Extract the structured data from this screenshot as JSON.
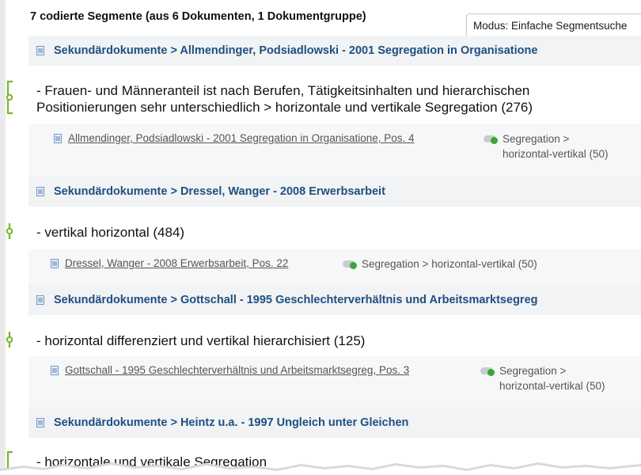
{
  "header": {
    "title": "7 codierte Segmente (aus 6 Dokumenten, 1 Dokumentgruppe)"
  },
  "mode_select": {
    "label": "Modus: Einfache Segmentsuche"
  },
  "documents": [
    {
      "title": "Sekundärdokumente > Allmendinger, Podsiadlowski - 2001 Segregation in Organisatione"
    },
    {
      "title": "Sekundärdokumente > Dressel, Wanger - 2008 Erwerbsarbeit"
    },
    {
      "title": "Sekundärdokumente > Gottschall - 1995 Geschlechterverhältnis und Arbeitsmarktsegreg"
    },
    {
      "title": "Sekundärdokumente > Heintz u.a. - 1997 Ungleich unter Gleichen"
    }
  ],
  "segments": [
    {
      "text_line1": "- Frauen- und Männeranteil ist nach Berufen, Tätigkeitsinhalten und hierarchischen",
      "text_line2": "Positionierungen sehr unterschiedlich > horizontale und vertikale Segregation (276)",
      "source": "Allmendinger, Podsiadlowski - 2001 Segregation in Organisatione, Pos. 4",
      "code_line1": "Segregation >",
      "code_line2": "horizontal-vertikal (50)"
    },
    {
      "text_line1": "- vertikal horizontal (484)",
      "source": "Dressel, Wanger - 2008 Erwerbsarbeit, Pos. 22",
      "code_line1": "Segregation > horizontal-vertikal (50)"
    },
    {
      "text_line1": "- horizontal differenziert und vertikal hierarchisiert (125)",
      "source": "Gottschall - 1995 Geschlechterverhältnis und Arbeitsmarktsegreg, Pos. 3",
      "code_line1": "Segregation >",
      "code_line2": "horizontal-vertikal (50)"
    },
    {
      "text_line1": "- horizontale und vertikale Segregation"
    }
  ],
  "colors": {
    "doc_title": "#1f4f82",
    "segment_marker": "#76b82a",
    "code_dot": "#3aa535"
  }
}
